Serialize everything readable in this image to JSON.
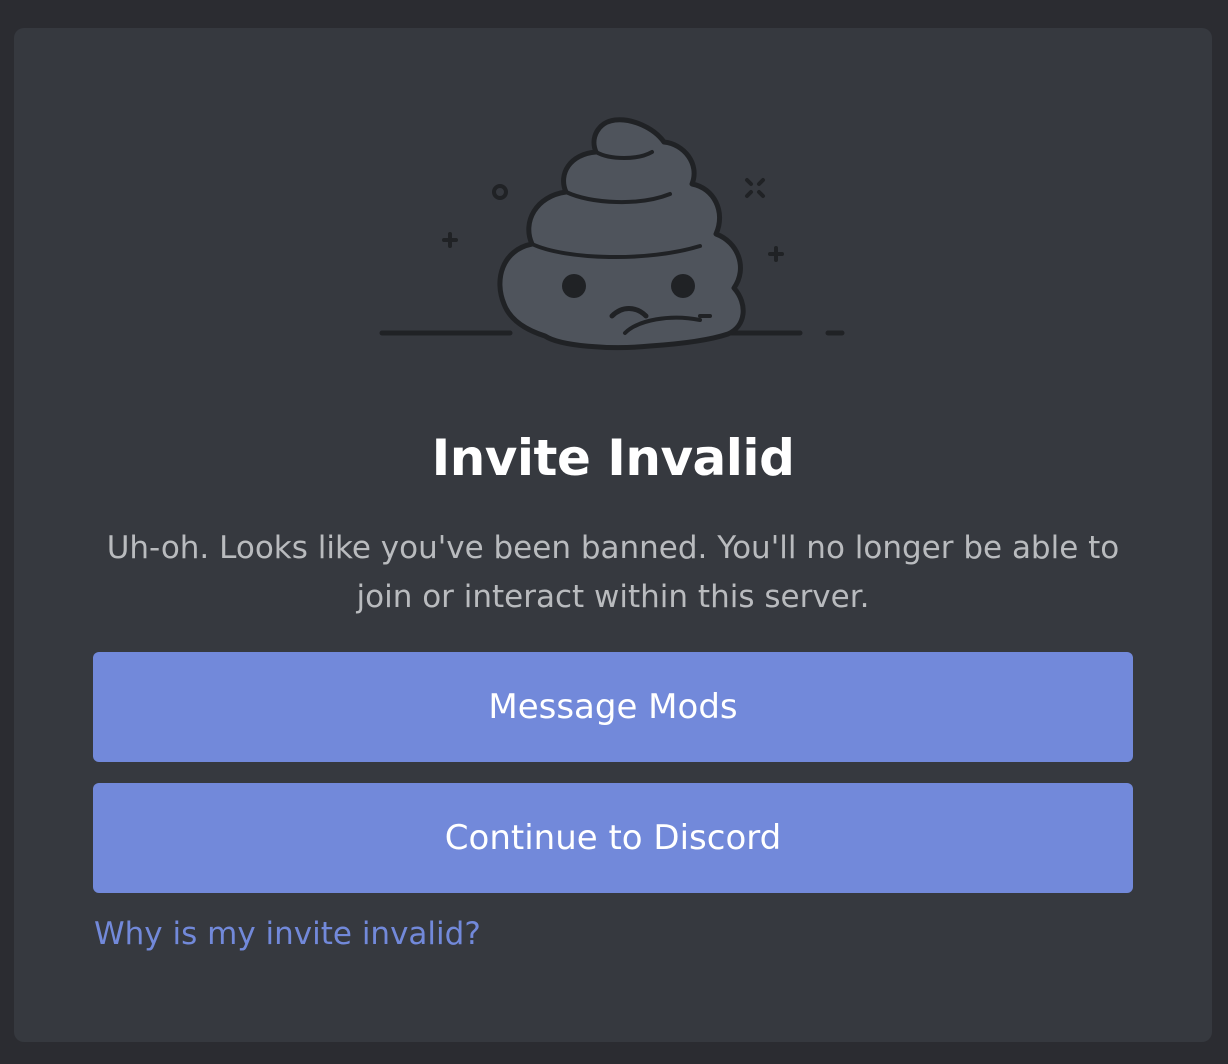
{
  "modal": {
    "title": "Invite Invalid",
    "description": "Uh-oh. Looks like you've been banned. You'll no longer be able to join or interact within this server.",
    "primary_button_label": "Message Mods",
    "secondary_button_label": "Continue to Discord",
    "help_link_text": "Why is my invite invalid?",
    "illustration_icon": "sad-poop-illustration"
  },
  "colors": {
    "background": "#2b2c31",
    "modal_background": "#36393f",
    "button_blurple": "#7289da",
    "title_text": "#ffffff",
    "body_text": "#b9bbbe",
    "link_text": "#7289da"
  }
}
